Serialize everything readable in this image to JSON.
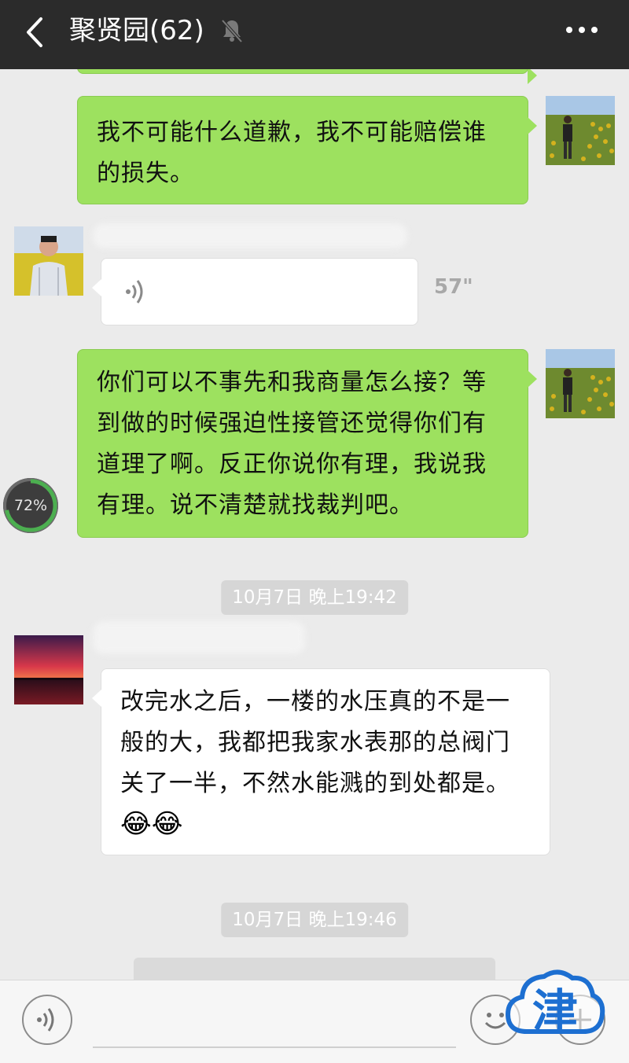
{
  "header": {
    "title": "聚贤园(62)",
    "icons": [
      "back-icon",
      "mute-bell-icon",
      "more-icon"
    ]
  },
  "messages": [
    {
      "side": "me",
      "text": "我不可能什么道歉，我不可能赔偿谁\n的损失。"
    },
    {
      "side": "them",
      "type": "voice",
      "duration": "57\""
    },
    {
      "side": "me",
      "text": "你们可以不事先和我商量怎么接？等\n到做的时候强迫性接管还觉得你们有\n道理了啊。反正你说你有理，我说我\n有理。说不清楚就找裁判吧。"
    },
    {
      "side": "them",
      "text": "改完水之后，一楼的水压真的不是一\n般的大，我都把我家水表那的总阀门\n关了一半，不然水能溅的到处都是。"
    }
  ],
  "timestamps": [
    "10月7日 晚上19:42",
    "10月7日 晚上19:46"
  ],
  "progress_overlay": {
    "label": "72%",
    "value": 72
  },
  "emoji": [
    "😂",
    "😂"
  ],
  "watermark": {
    "text": "津"
  }
}
